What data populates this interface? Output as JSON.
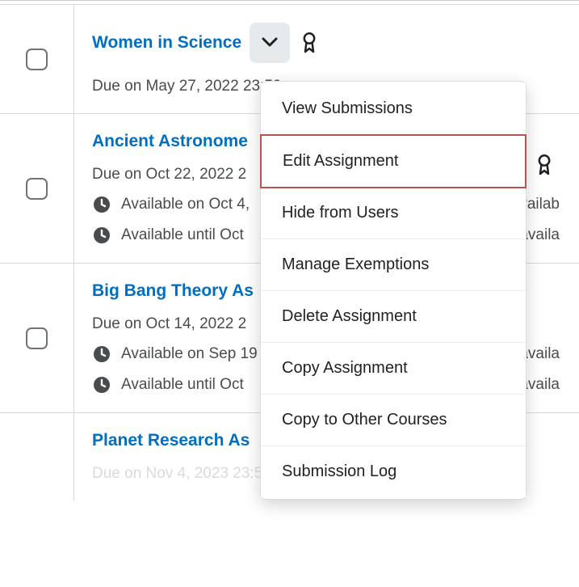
{
  "rows": [
    {
      "title": "Women in Science",
      "due": "Due on May 27, 2022 23:59",
      "avail_on": null,
      "avail_until": null
    },
    {
      "title": "Ancient Astronome",
      "due": "Due on Oct 22, 2022 2",
      "avail_on": "Available on Oct 4,",
      "avail_on_trail": "e availab",
      "avail_until": "Available until Oct",
      "avail_until_trail": "er availa"
    },
    {
      "title": "Big Bang Theory As",
      "due": "Due on Oct 14, 2022 2",
      "avail_on": "Available on Sep 19",
      "avail_on_trail": "re availa",
      "avail_until": "Available until Oct",
      "avail_until_trail": "er availa"
    },
    {
      "title": "Planet Research As",
      "due": "Due on Nov 4, 2023 23:59",
      "avail_on": null,
      "avail_until": null
    }
  ],
  "menu": {
    "items": [
      "View Submissions",
      "Edit Assignment",
      "Hide from Users",
      "Manage Exemptions",
      "Delete Assignment",
      "Copy Assignment",
      "Copy to Other Courses",
      "Submission Log"
    ],
    "highlight_index": 1
  }
}
